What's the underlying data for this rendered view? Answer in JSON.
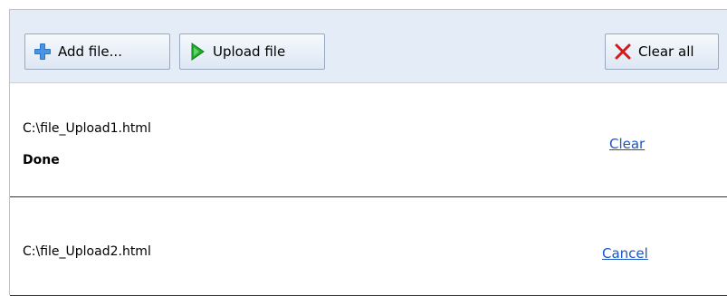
{
  "toolbar": {
    "add_label": "Add file...",
    "upload_label": "Upload file",
    "clear_all_label": "Clear all"
  },
  "files": [
    {
      "name": "C:\\file_Upload1.html",
      "status": "Done",
      "action": "Clear"
    },
    {
      "name": "C:\\file_Upload2.html",
      "status": "",
      "action": "Cancel"
    }
  ],
  "icons": {
    "add": "plus-icon",
    "upload": "play-arrow-icon",
    "clear_all": "x-icon"
  },
  "colors": {
    "toolbar_bg": "#e3ecf7",
    "add_icon": "#2a73c9",
    "upload_icon": "#1fae2a",
    "clear_icon": "#d11a1a",
    "link": "#1b55c4"
  }
}
